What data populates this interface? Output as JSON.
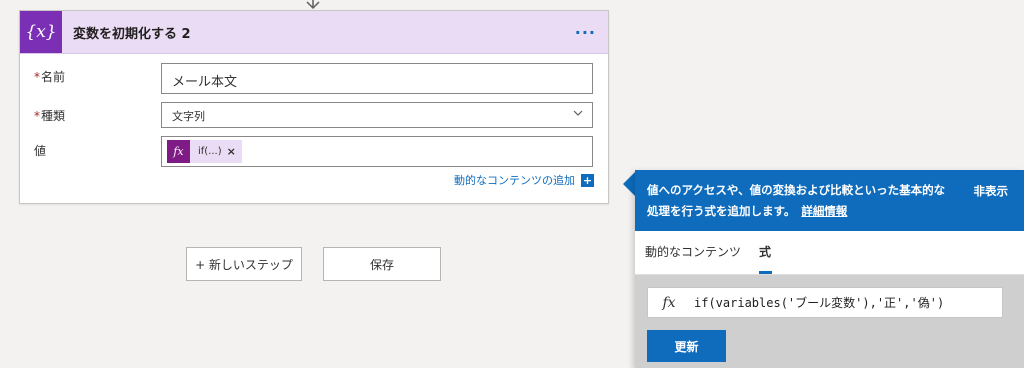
{
  "action": {
    "icon_text": "{x}",
    "title": "変数を初期化する 2",
    "more_label": "···",
    "fields": {
      "name_label": "名前",
      "name_value": "メール本文",
      "type_label": "種類",
      "type_value": "文字列",
      "value_label": "値",
      "token_icon": "fx",
      "token_text": "if(...)",
      "token_remove": "×"
    },
    "dynamic_content_link": "動的なコンテンツの追加",
    "required_mark": "*"
  },
  "buttons": {
    "new_step": "+ 新しいステップ",
    "save": "保存"
  },
  "flyout": {
    "description": "値へのアクセスや、値の変換および比較といった基本的な処理を行う式を追加します。",
    "more_info": "詳細情報",
    "hide": "非表示",
    "tabs": [
      "動的なコンテンツ",
      "式"
    ],
    "active_tab": "式",
    "expression_icon": "fx",
    "expression": "if(variables('ブール変数'),'正','偽')",
    "update_button": "更新"
  },
  "colors": {
    "accent": "#0f6cbd",
    "variable_purple": "#7b2fb5",
    "header_bg": "#ebdcf5",
    "required": "#a4262c"
  }
}
